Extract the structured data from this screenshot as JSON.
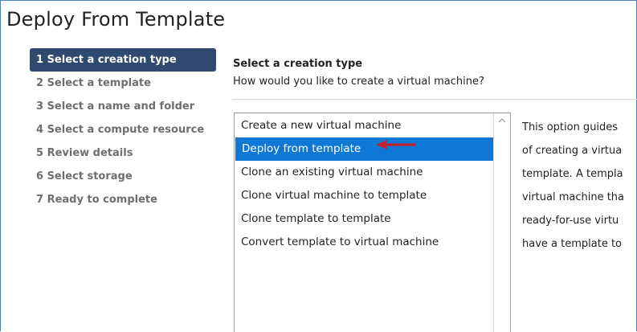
{
  "dialog": {
    "title": "Deploy From Template"
  },
  "steps": [
    {
      "label": "1 Select a creation type",
      "active": true
    },
    {
      "label": "2 Select a template",
      "active": false
    },
    {
      "label": "3 Select a name and folder",
      "active": false
    },
    {
      "label": "4 Select a compute resource",
      "active": false
    },
    {
      "label": "5 Review details",
      "active": false
    },
    {
      "label": "6 Select storage",
      "active": false
    },
    {
      "label": "7 Ready to complete",
      "active": false
    }
  ],
  "content": {
    "title": "Select a creation type",
    "question": "How would you like to create a virtual machine?"
  },
  "options": [
    {
      "label": "Create a new virtual machine"
    },
    {
      "label": "Deploy from template",
      "selected": true
    },
    {
      "label": "Clone an existing virtual machine"
    },
    {
      "label": "Clone virtual machine to template"
    },
    {
      "label": "Clone template to template"
    },
    {
      "label": "Convert template to virtual machine"
    }
  ],
  "description": [
    "This option guides",
    "of creating a virtua",
    "template. A templa",
    "virtual machine tha",
    "ready-for-use virtu",
    "have a template to"
  ],
  "colors": {
    "step_active_bg": "#2f4a6e",
    "selection_bg": "#0f78d4",
    "annotation_arrow": "#c0232b"
  },
  "icons": {
    "scroll_up": "chevron-up-icon",
    "annotation": "red-arrow-icon"
  }
}
